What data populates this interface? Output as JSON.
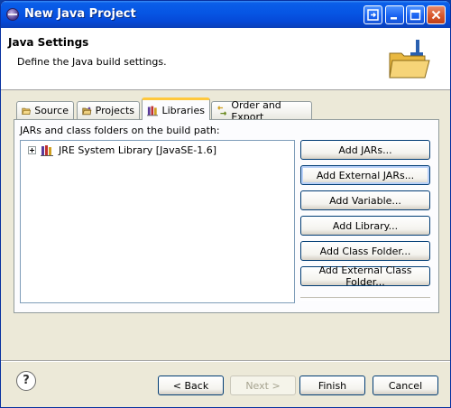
{
  "window": {
    "title": "New Java Project"
  },
  "header": {
    "title": "Java Settings",
    "description": "Define the Java build settings."
  },
  "tabs": [
    {
      "label": "Source",
      "icon": "source-folder-icon"
    },
    {
      "label": "Projects",
      "icon": "projects-icon"
    },
    {
      "label": "Libraries",
      "icon": "libraries-icon",
      "active": true
    },
    {
      "label": "Order and Export",
      "icon": "order-export-icon"
    }
  ],
  "libraries": {
    "label": "JARs and class folders on the build path:",
    "tree": [
      {
        "label": "JRE System Library [JavaSE-1.6]",
        "expanded": false
      }
    ],
    "buttons": {
      "add_jars": "Add JARs...",
      "add_external_jars": "Add External JARs...",
      "add_variable": "Add Variable...",
      "add_library": "Add Library...",
      "add_class_folder": "Add Class Folder...",
      "add_external_class_folder": "Add External Class Folder..."
    }
  },
  "footer": {
    "help": "?",
    "back": "< Back",
    "next": "Next >",
    "finish": "Finish",
    "cancel": "Cancel"
  }
}
